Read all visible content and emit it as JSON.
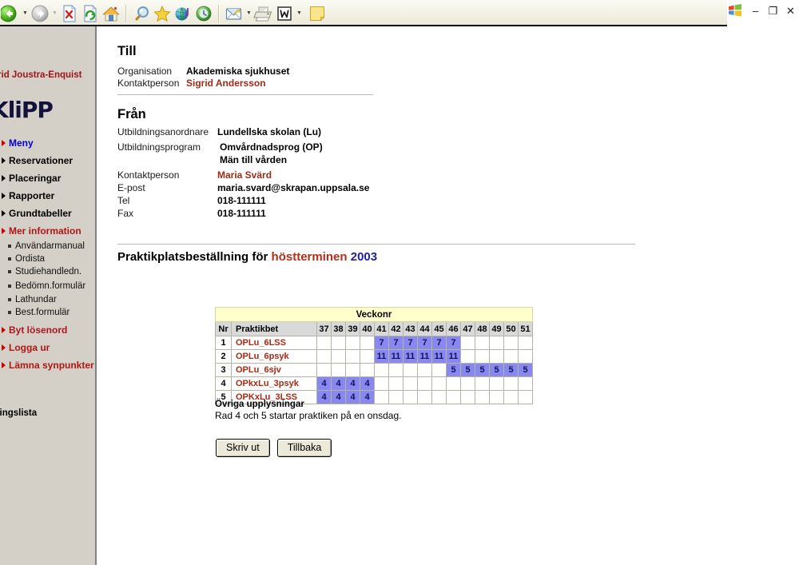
{
  "browser": {
    "toolbar_items": [
      {
        "name": "back-button",
        "icon": "back-arrow-icon",
        "has_caret": true
      },
      {
        "name": "forward-button",
        "icon": "forward-arrow-icon",
        "has_caret": true
      },
      {
        "name": "stop-button",
        "icon": "stop-icon",
        "has_caret": false
      },
      {
        "name": "refresh-button",
        "icon": "refresh-icon",
        "has_caret": false
      },
      {
        "name": "home-button",
        "icon": "home-icon",
        "has_caret": false
      },
      {
        "name": "search-button",
        "icon": "search-icon",
        "has_caret": false
      },
      {
        "name": "favorites-button",
        "icon": "star-icon",
        "has_caret": false
      },
      {
        "name": "media-button",
        "icon": "media-globe-icon",
        "has_caret": false
      },
      {
        "name": "history-button",
        "icon": "history-icon",
        "has_caret": false
      },
      {
        "name": "mail-button",
        "icon": "mail-icon",
        "has_caret": true
      },
      {
        "name": "print-button",
        "icon": "printer-icon",
        "has_caret": false
      },
      {
        "name": "edit-button",
        "icon": "word-edit-icon",
        "has_caret": true
      },
      {
        "name": "notes-button",
        "icon": "note-icon",
        "has_caret": false
      }
    ],
    "window_controls": {
      "logo": "windows-logo-icon",
      "minimize": "–",
      "restore": "❐",
      "close": "✕"
    }
  },
  "sidebar": {
    "user": "grid Joustra-Enquist",
    "logo": "KliPP",
    "top_items": [
      {
        "label": "Meny",
        "color": "blue",
        "arrow": "red"
      },
      {
        "label": "Reservationer",
        "color": "black",
        "arrow": "black"
      },
      {
        "label": "Placeringar",
        "color": "black",
        "arrow": "black"
      },
      {
        "label": "Rapporter",
        "color": "black",
        "arrow": "black"
      },
      {
        "label": "Grundtabeller",
        "color": "black",
        "arrow": "black"
      },
      {
        "label": "Mer information",
        "color": "red",
        "arrow": "red"
      }
    ],
    "sub_items": [
      "Användarmanual",
      "Ordista",
      "Studiehandledn.",
      "Bedömn.formulär",
      "Lathundar",
      "Best.formulär"
    ],
    "bottom_items": [
      {
        "label": "Byt lösenord",
        "color": "red",
        "arrow": "red"
      },
      {
        "label": "Logga ur",
        "color": "red",
        "arrow": "red"
      },
      {
        "label": "Lämna synpunkter",
        "color": "red",
        "arrow": "red"
      }
    ],
    "footer_text": "dringslista"
  },
  "main": {
    "till": {
      "heading": "Till",
      "organisation_label": "Organisation",
      "organisation_value": "Akademiska sjukhuset",
      "kontaktperson_label": "Kontaktperson",
      "kontaktperson_value": "Sigrid Andersson"
    },
    "fran": {
      "heading": "Från",
      "utbildningsanordnare_label": "Utbildningsanordnare",
      "utbildningsanordnare_value": "Lundellska skolan (Lu)",
      "utbildningsprogram_label": "Utbildningsprogram",
      "utbildningsprogram_value1": "Omvårdnadsprog (OP)",
      "utbildningsprogram_value2": "Män till vården",
      "kontaktperson_label": "Kontaktperson",
      "kontaktperson_value": "Maria Svärd",
      "epost_label": "E-post",
      "epost_value": "maria.svard@skrapan.uppsala.se",
      "tel_label": "Tel",
      "tel_value": "018-111111",
      "fax_label": "Fax",
      "fax_value": "018-111111"
    },
    "order_title": {
      "prefix": "Praktikplatsbeställning för ",
      "term": "höstterminen",
      "year": "2003"
    },
    "table": {
      "group_header": "Veckonr",
      "col_nr": "Nr",
      "col_label": "Praktikbet",
      "weeks": [
        37,
        38,
        39,
        40,
        41,
        42,
        43,
        44,
        45,
        46,
        47,
        48,
        49,
        50,
        51
      ],
      "rows": [
        {
          "nr": "1",
          "label": "OPLu_6LSS",
          "cells": [
            "",
            "",
            "",
            "",
            "7",
            "7",
            "7",
            "7",
            "7",
            "7",
            "",
            "",
            "",
            "",
            ""
          ]
        },
        {
          "nr": "2",
          "label": "OPLu_6psyk",
          "cells": [
            "",
            "",
            "",
            "",
            "11",
            "11",
            "11",
            "11",
            "11",
            "11",
            "",
            "",
            "",
            "",
            ""
          ]
        },
        {
          "nr": "3",
          "label": "OPLu_6sjv",
          "cells": [
            "",
            "",
            "",
            "",
            "",
            "",
            "",
            "",
            "",
            "5",
            "5",
            "5",
            "5",
            "5",
            "5"
          ]
        },
        {
          "nr": "4",
          "label": "OPkxLu_3psyk",
          "cells": [
            "4",
            "4",
            "4",
            "4",
            "",
            "",
            "",
            "",
            "",
            "",
            "",
            "",
            "",
            "",
            ""
          ]
        },
        {
          "nr": "5",
          "label": "OPKxLu_3LSS",
          "cells": [
            "4",
            "4",
            "4",
            "4",
            "",
            "",
            "",
            "",
            "",
            "",
            "",
            "",
            "",
            "",
            ""
          ]
        }
      ]
    },
    "ovriga": {
      "heading": "Övriga upplysningar",
      "text": "Rad 4 och 5 startar praktiken på en onsdag."
    },
    "buttons": {
      "print": "Skriv ut",
      "back": "Tillbaka"
    }
  },
  "colors": {
    "cell_fill": "#8888ee",
    "group_header_bg": "#ffffcc",
    "accent_red": "#a82a12",
    "sidebar_bg": "#d4d0c8"
  }
}
